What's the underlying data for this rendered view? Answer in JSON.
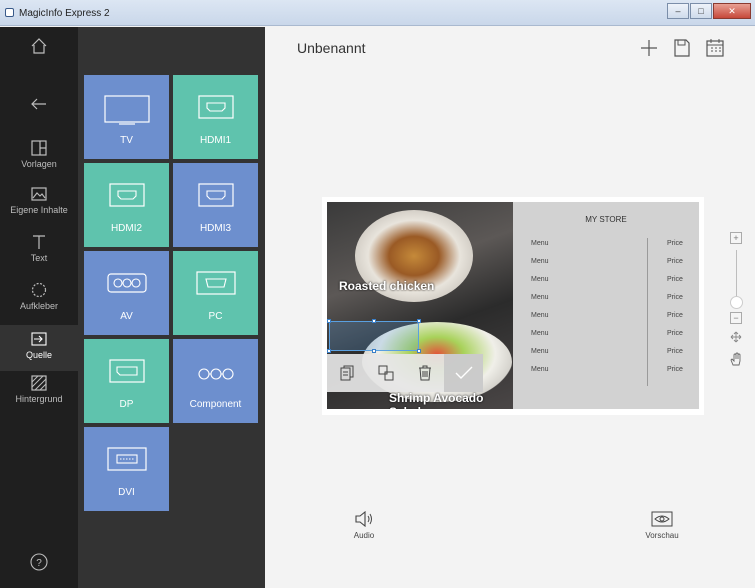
{
  "window": {
    "title": "MagicInfo Express 2",
    "min": "–",
    "max": "□",
    "close": "✕"
  },
  "rail": {
    "items": [
      {
        "key": "home",
        "label": ""
      },
      {
        "key": "back",
        "label": ""
      },
      {
        "key": "templates",
        "label": "Vorlagen"
      },
      {
        "key": "own_content",
        "label": "Eigene Inhalte"
      },
      {
        "key": "text",
        "label": "Text"
      },
      {
        "key": "stickers",
        "label": "Aufkleber"
      },
      {
        "key": "source",
        "label": "Quelle"
      },
      {
        "key": "background",
        "label": "Hintergrund"
      }
    ],
    "help": "?"
  },
  "sources": [
    {
      "label": "TV",
      "color": "blue",
      "icon": "tv-icon"
    },
    {
      "label": "HDMI1",
      "color": "teal",
      "icon": "hdmi-icon"
    },
    {
      "label": "HDMI2",
      "color": "teal",
      "icon": "hdmi-icon"
    },
    {
      "label": "HDMI3",
      "color": "blue",
      "icon": "hdmi-icon"
    },
    {
      "label": "AV",
      "color": "blue",
      "icon": "av-icon"
    },
    {
      "label": "PC",
      "color": "teal",
      "icon": "pc-icon"
    },
    {
      "label": "DP",
      "color": "teal",
      "icon": "dp-icon"
    },
    {
      "label": "Component",
      "color": "blue",
      "icon": "component-icon"
    },
    {
      "label": "DVI",
      "color": "blue",
      "icon": "dvi-icon"
    }
  ],
  "main": {
    "title": "Unbenannt",
    "audio_label": "Audio",
    "preview_label": "Vorschau"
  },
  "canvas": {
    "caption_top": "Roasted chicken",
    "caption_bottom": "Shrimp Avocado Salad",
    "store_title": "MY STORE",
    "rows": [
      {
        "menu": "Menu",
        "price": "Price"
      },
      {
        "menu": "Menu",
        "price": "Price"
      },
      {
        "menu": "Menu",
        "price": "Price"
      },
      {
        "menu": "Menu",
        "price": "Price"
      },
      {
        "menu": "Menu",
        "price": "Price"
      },
      {
        "menu": "Menu",
        "price": "Price"
      },
      {
        "menu": "Menu",
        "price": "Price"
      },
      {
        "menu": "Menu",
        "price": "Price"
      }
    ]
  },
  "zoom": {
    "plus": "+",
    "minus": "−"
  },
  "colors": {
    "tile_blue": "#6d8fce",
    "tile_teal": "#5fc3ad",
    "rail": "#1f1f1f",
    "panel": "#333333"
  }
}
